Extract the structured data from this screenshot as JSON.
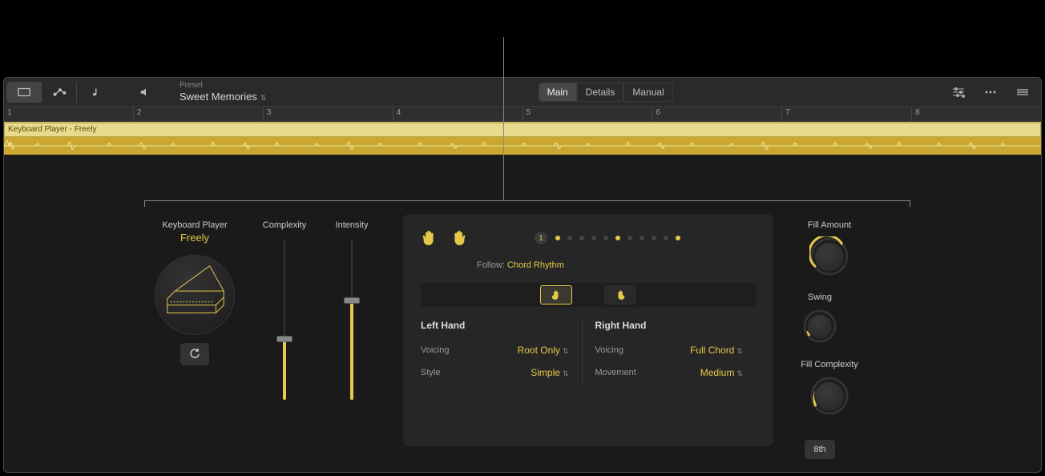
{
  "toolbar": {
    "preset_label": "Preset",
    "preset_name": "Sweet Memories",
    "tabs": [
      "Main",
      "Details",
      "Manual"
    ],
    "active_tab": "Main"
  },
  "ruler": {
    "bars": [
      "1",
      "2",
      "3",
      "4",
      "5",
      "6",
      "7",
      "8"
    ]
  },
  "clip": {
    "name": "Keyboard Player - Freely"
  },
  "player": {
    "label": "Keyboard Player",
    "name": "Freely",
    "complexity_label": "Complexity",
    "complexity_value": 0.38,
    "intensity_label": "Intensity",
    "intensity_value": 0.62
  },
  "beats": {
    "badge": "1",
    "pattern": [
      true,
      false,
      false,
      false,
      false,
      true,
      false,
      false,
      false,
      false,
      true
    ],
    "follow_label": "Follow:",
    "follow_value": "Chord Rhythm"
  },
  "left_hand": {
    "title": "Left Hand",
    "voicing_label": "Voicing",
    "voicing_value": "Root Only",
    "style_label": "Style",
    "style_value": "Simple"
  },
  "right_hand": {
    "title": "Right Hand",
    "voicing_label": "Voicing",
    "voicing_value": "Full Chord",
    "movement_label": "Movement",
    "movement_value": "Medium"
  },
  "knobs": {
    "fill_amount_label": "Fill Amount",
    "fill_amount_value": 0.55,
    "fill_complexity_label": "Fill Complexity",
    "fill_complexity_value": 0.3,
    "swing_label": "Swing",
    "swing_value": 0.2,
    "swing_division": "8th"
  },
  "colors": {
    "accent": "#e6c84a"
  }
}
